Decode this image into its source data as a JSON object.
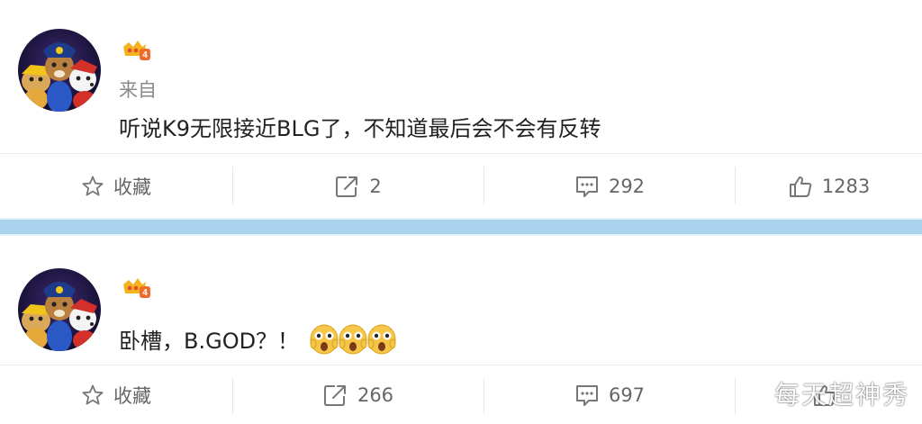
{
  "posts": [
    {
      "source": "来自",
      "text": "听说K9无限接近BLG了，不知道最后会不会有反转",
      "actions": {
        "favorite": "收藏",
        "repost": "2",
        "comment": "292",
        "like": "1283"
      }
    },
    {
      "text": "卧槽，B.GOD？！",
      "emoji_count": 3,
      "actions": {
        "favorite": "收藏",
        "repost": "266",
        "comment": "697",
        "like": ""
      }
    }
  ],
  "watermark": "每天超神秀",
  "colors": {
    "separator": "#a9d3ec",
    "action_text": "#666666",
    "badge": "#f5b41e"
  }
}
